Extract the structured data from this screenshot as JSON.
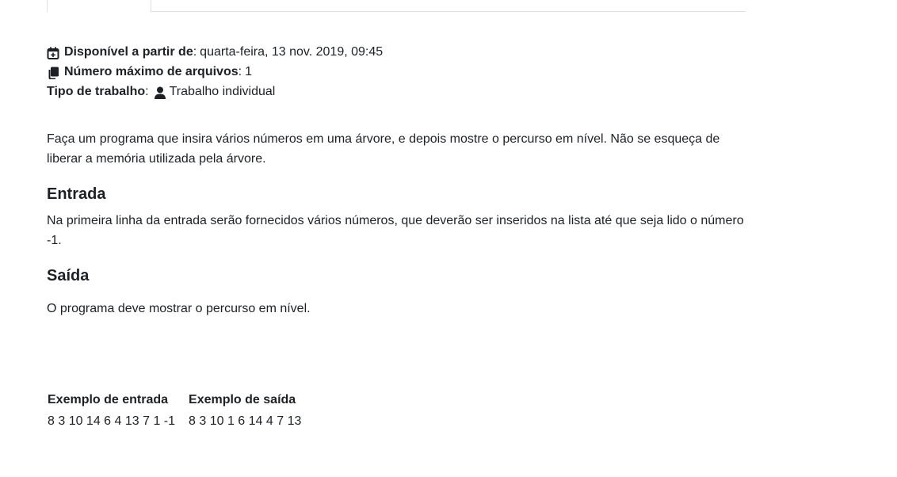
{
  "meta": {
    "available_from_label": "Disponível a partir de",
    "available_from_value": "quarta-feira, 13 nov. 2019, 09:45",
    "max_files_label": "Número máximo de arquivos",
    "max_files_value": "1",
    "work_type_label": "Tipo de trabalho",
    "work_type_value": "Trabalho individual",
    "icons": [
      "calendar-plus-icon",
      "copy-files-icon",
      "user-icon"
    ]
  },
  "description": {
    "intro": "Faça um programa que insira vários números em uma árvore, e depois mostre o percurso em nível. Não se esqueça de liberar a memória utilizada pela árvore.",
    "input_heading": "Entrada",
    "input_text": "Na primeira linha da entrada serão fornecidos vários números, que deverão ser inseridos na lista até que seja lido o número -1.",
    "output_heading": "Saída",
    "output_text": "O programa deve mostrar o percurso em nível."
  },
  "examples": {
    "headers": [
      "Exemplo de entrada",
      "Exemplo de saída"
    ],
    "rows": [
      [
        "8 3 10 14 6 4 13 7 1 -1",
        "8 3 10 1 6 14 4 7 13"
      ]
    ]
  },
  "colors": {
    "text": "#1d2125",
    "border": "#dee2e6",
    "background": "#ffffff"
  }
}
